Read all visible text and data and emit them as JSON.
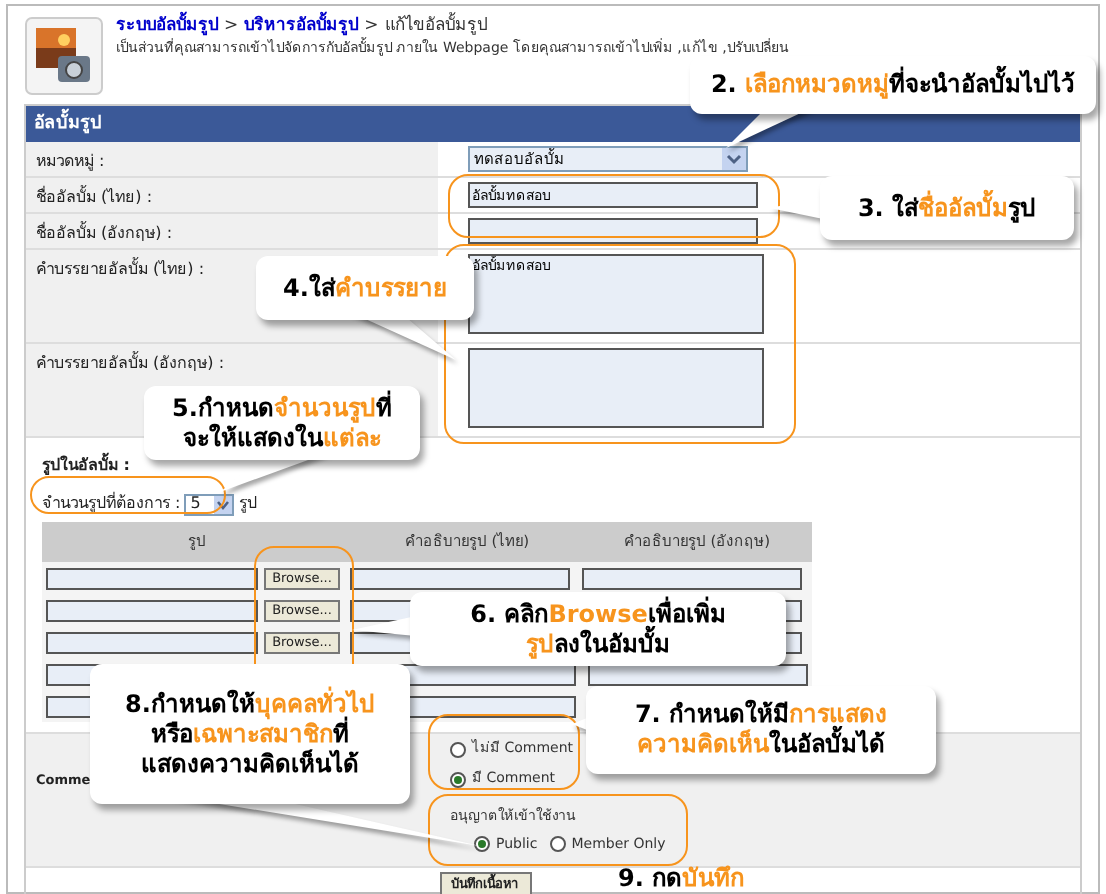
{
  "header": {
    "breadcrumb": [
      {
        "label": "ระบบอัลบั้มรูป",
        "kind": "link"
      },
      {
        "label": ">",
        "kind": "separator"
      },
      {
        "label": "บริหารอัลบั้มรูป",
        "kind": "link"
      },
      {
        "label": ">",
        "kind": "separator"
      },
      {
        "label": "แก้ไขอัลบั้มรูป",
        "kind": "current"
      }
    ],
    "description": "เป็นส่วนที่คุณสามารถเข้าไปจัดการกับอัลบั้มรูป ภายใน Webpage โดยคุณสามารถเข้าไปเพิ่ม ,แก้ไข ,ปรับเปลี่ยน"
  },
  "form": {
    "title": "อัลบั้มรูป",
    "rows": [
      {
        "label": "หมวดหมู่ :",
        "kind": "select",
        "value": "ทดสอบอัลบั้ม"
      },
      {
        "label": "ชื่ออัลบั้ม (ไทย) :",
        "kind": "input",
        "value": "อัลบั้มทดสอบ"
      },
      {
        "label": "ชื่ออัลบั้ม (อังกฤษ) :",
        "kind": "input"
      },
      {
        "label": "คำบรรยายอัลบั้ม (ไทย) :",
        "kind": "textarea",
        "value": "อัลบั้มทดสอบ"
      },
      {
        "label": "คำบรรยายอัลบั้ม (อังกฤษ) :",
        "kind": "textarea"
      }
    ],
    "photos": {
      "title": "รูปในอัลบั้ม :",
      "count_label": "จำนวนรูปที่ต้องการ :",
      "count": "5",
      "unit": "รูป",
      "columns": [
        "รูป",
        "คำอธิบายรูป (ไทย)",
        "คำอธิบายรูป (อังกฤษ)"
      ],
      "rows": [
        {
          "kind": "browse",
          "browse": "Browse..."
        },
        {
          "kind": "browse",
          "browse": "Browse..."
        },
        {
          "kind": "browse",
          "browse": "Browse..."
        },
        {
          "kind": "plain"
        },
        {
          "kind": "partial"
        }
      ]
    },
    "comment": {
      "label": "Comme",
      "options": [
        {
          "label": "ไม่มี Comment",
          "selected": false
        },
        {
          "label": "มี Comment",
          "selected": true
        }
      ]
    },
    "access": {
      "label": "อนุญาตให้เข้าใช้งาน",
      "options": [
        {
          "label": "Public",
          "selected": true
        },
        {
          "label": "Member Only",
          "selected": false
        }
      ]
    },
    "submit": "บันทึกเนื้อหา"
  },
  "callouts": [
    {
      "kind": "bubble",
      "lines": [
        [
          {
            "text": "2. ",
            "highlight": false
          },
          {
            "text": "เลือกหมวดหมู่",
            "highlight": true
          },
          {
            "text": "ที่จะนำอัลบั้มไปไว้",
            "highlight": false
          }
        ]
      ]
    },
    {
      "kind": "bubble",
      "lines": [
        [
          {
            "text": "3. ใส่",
            "highlight": false
          },
          {
            "text": "ชื่ออัลบั้ม",
            "highlight": true
          },
          {
            "text": "รูป",
            "highlight": false
          }
        ]
      ]
    },
    {
      "kind": "bubble",
      "lines": [
        [
          {
            "text": "4.ใส่",
            "highlight": false
          },
          {
            "text": "คำบรรยาย",
            "highlight": true
          }
        ]
      ]
    },
    {
      "kind": "bubble",
      "lines": [
        [
          {
            "text": "5.กำหนด",
            "highlight": false
          },
          {
            "text": "จำนวนรูป",
            "highlight": true
          },
          {
            "text": "ที่",
            "highlight": false
          }
        ],
        [
          {
            "text": "จะให้แสดงใน",
            "highlight": false
          },
          {
            "text": "แต่ละ",
            "highlight": true
          }
        ]
      ]
    },
    {
      "kind": "bubble",
      "lines": [
        [
          {
            "text": "6. คลิก",
            "highlight": false
          },
          {
            "text": "Browse",
            "highlight": true
          },
          {
            "text": "เพื่อเพิ่ม",
            "highlight": false
          }
        ],
        [
          {
            "text": "รูป",
            "highlight": true
          },
          {
            "text": "ลงในอัมบั้ม",
            "highlight": false
          }
        ]
      ]
    },
    {
      "kind": "bubble",
      "lines": [
        [
          {
            "text": "8.กำหนดให้",
            "highlight": false
          },
          {
            "text": "บุคคลทั่วไป",
            "highlight": true
          }
        ],
        [
          {
            "text": "หรือ",
            "highlight": false
          },
          {
            "text": "เฉพาะสมาชิก",
            "highlight": true
          },
          {
            "text": "ที่",
            "highlight": false
          }
        ],
        [
          {
            "text": "แสดงความคิดเห็นได้",
            "highlight": false
          }
        ]
      ]
    },
    {
      "kind": "bubble",
      "lines": [
        [
          {
            "text": "7. กำหนดให้มี",
            "highlight": false
          },
          {
            "text": "การแสดง",
            "highlight": true
          }
        ],
        [
          {
            "text": "ความคิดเห็น",
            "highlight": true
          },
          {
            "text": "ในอัลบั้มได้",
            "highlight": false
          }
        ]
      ]
    },
    {
      "kind": "plain",
      "lines": [
        [
          {
            "text": "9. กด",
            "highlight": false
          },
          {
            "text": "บันทึก",
            "highlight": true
          }
        ]
      ]
    }
  ]
}
